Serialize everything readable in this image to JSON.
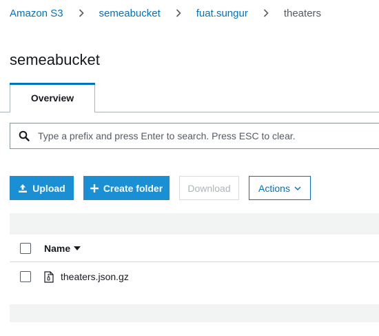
{
  "breadcrumb": {
    "items": [
      "Amazon S3",
      "semeabucket",
      "fuat.sungur",
      "theaters"
    ]
  },
  "page_title": "semeabucket",
  "tabs": [
    {
      "label": "Overview",
      "active": true
    }
  ],
  "search": {
    "placeholder": "Type a prefix and press Enter to search. Press ESC to clear.",
    "value": ""
  },
  "toolbar": {
    "upload_label": "Upload",
    "create_folder_label": "Create folder",
    "download_label": "Download",
    "actions_label": "Actions"
  },
  "table": {
    "columns": [
      "Name"
    ],
    "rows": [
      {
        "name": "theaters.json.gz",
        "icon": "file-archive-icon"
      }
    ]
  },
  "colors": {
    "link": "#0073bb",
    "primary_button": "#1a8fd3",
    "band": "#f2f3f3"
  }
}
